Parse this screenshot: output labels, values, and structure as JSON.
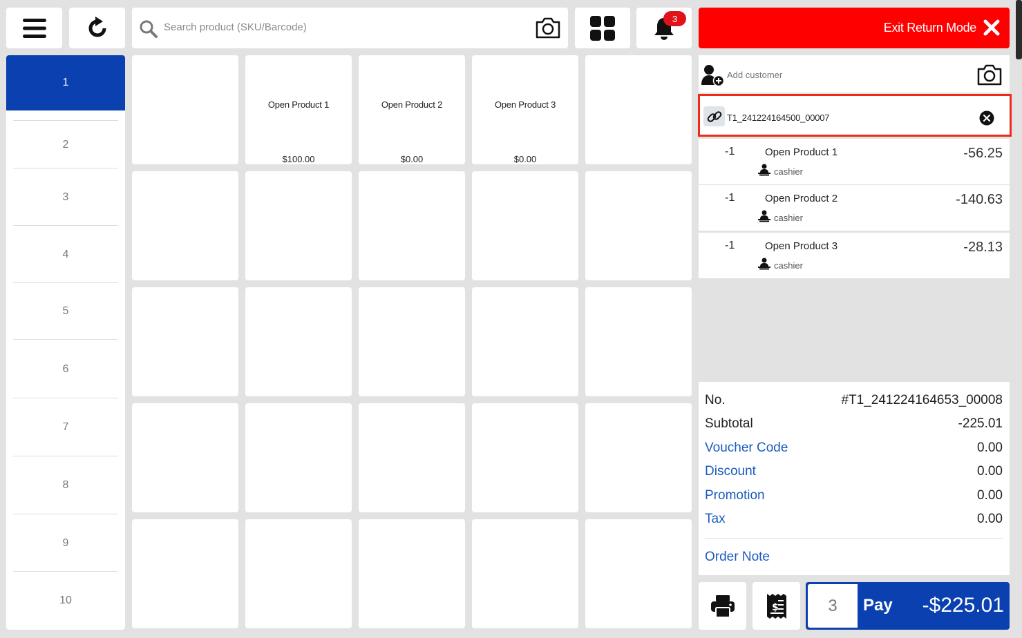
{
  "topbar": {
    "search_placeholder": "Search product (SKU/Barcode)",
    "notification_count": "3",
    "exit_label": "Exit Return Mode"
  },
  "tabs": [
    "1",
    "2",
    "3",
    "4",
    "5",
    "6",
    "7",
    "8",
    "9",
    "10"
  ],
  "active_tab": "1",
  "products": [
    {
      "name": "",
      "price": ""
    },
    {
      "name": "Open Product 1",
      "price": "$100.00"
    },
    {
      "name": "Open Product 2",
      "price": "$0.00"
    },
    {
      "name": "Open Product 3",
      "price": "$0.00"
    },
    {
      "name": "",
      "price": ""
    }
  ],
  "customer": {
    "add_label": "Add customer"
  },
  "linked_order": {
    "reference": "T1_241224164500_00007"
  },
  "cart": [
    {
      "qty": "-1",
      "name": "Open Product 1",
      "staff": "cashier",
      "amount": "-56.25"
    },
    {
      "qty": "-1",
      "name": "Open Product 2",
      "staff": "cashier",
      "amount": "-140.63"
    },
    {
      "qty": "-1",
      "name": "Open Product 3",
      "staff": "cashier",
      "amount": "-28.13"
    }
  ],
  "summary": {
    "no_label": "No.",
    "no_value": "#T1_241224164653_00008",
    "subtotal_label": "Subtotal",
    "subtotal_value": "-225.01",
    "voucher_label": "Voucher Code",
    "voucher_value": "0.00",
    "discount_label": "Discount",
    "discount_value": "0.00",
    "promotion_label": "Promotion",
    "promotion_value": "0.00",
    "tax_label": "Tax",
    "tax_value": "0.00",
    "order_note_label": "Order Note"
  },
  "pay": {
    "item_count": "3",
    "label": "Pay",
    "total": "-$225.01"
  },
  "colors": {
    "primary_blue": "#0a40b0",
    "exit_red": "#ff0000",
    "highlight_red": "#ee2b19",
    "link_blue": "#1a5bbd"
  }
}
